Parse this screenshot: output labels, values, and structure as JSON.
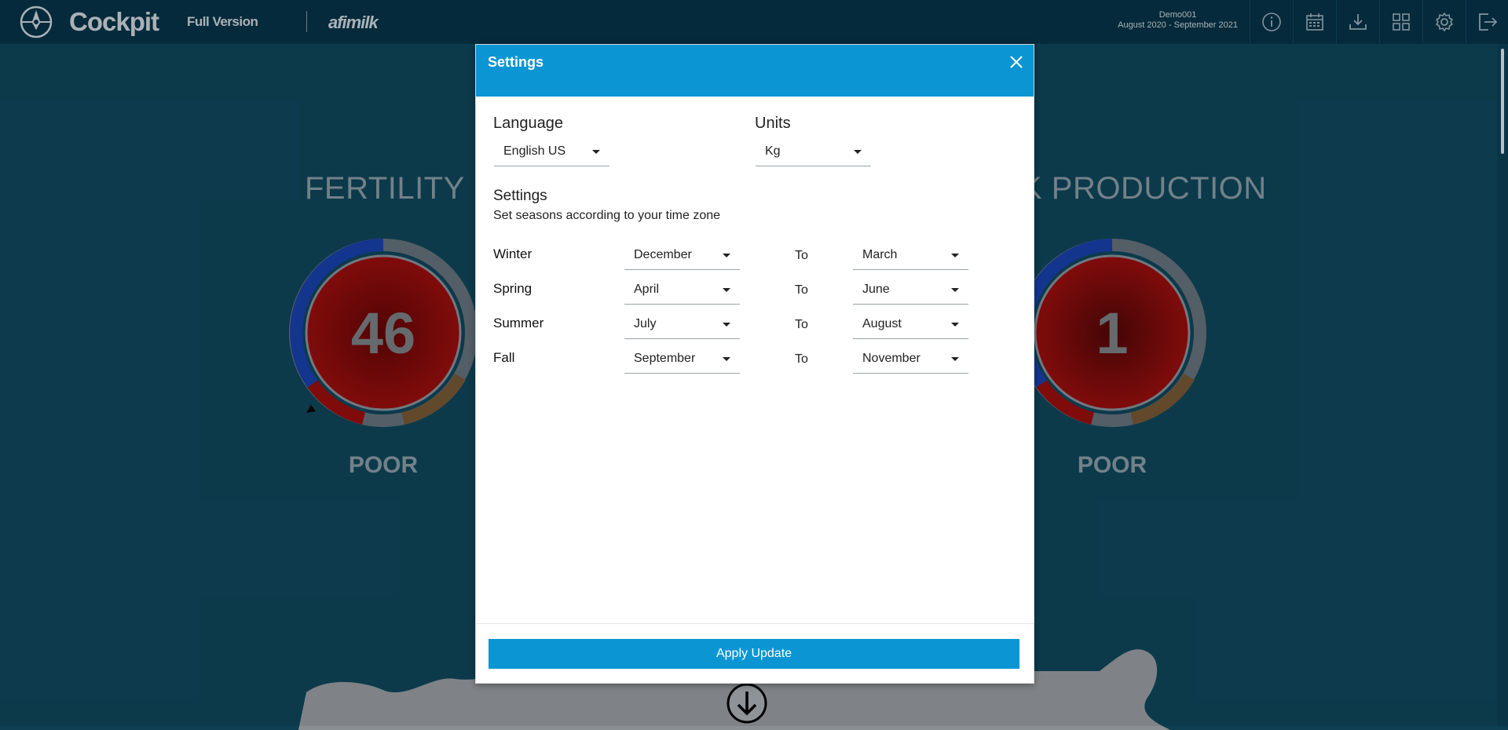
{
  "header": {
    "brand": "Cockpit",
    "version": "Full Version",
    "company": "afimilk",
    "farm_name": "Demo001",
    "date_range": "August 2020 - September 2021",
    "icons": [
      "info-icon",
      "calendar-icon",
      "download-icon",
      "grid-icon",
      "gear-icon",
      "logout-icon"
    ]
  },
  "dashboard": {
    "left": {
      "title": "FERTILITY",
      "value": "46",
      "rating": "POOR"
    },
    "right": {
      "title": "K PRODUCTION",
      "value": "1",
      "rating": "POOR"
    }
  },
  "modal": {
    "title": "Settings",
    "language": {
      "label": "Language",
      "value": "English US"
    },
    "units": {
      "label": "Units",
      "value": "Kg"
    },
    "settings_label": "Settings",
    "settings_hint": "Set seasons according to your time zone",
    "to_label": "To",
    "seasons": [
      {
        "name": "Winter",
        "from": "December",
        "to": "March"
      },
      {
        "name": "Spring",
        "from": "April",
        "to": "June"
      },
      {
        "name": "Summer",
        "from": "July",
        "to": "August"
      },
      {
        "name": "Fall",
        "from": "September",
        "to": "November"
      }
    ],
    "apply_label": "Apply Update"
  },
  "colors": {
    "background": "#0e3f52",
    "topbar": "#062e40",
    "accent": "#0b96d3",
    "gauge_red": "#7a0a0a"
  }
}
